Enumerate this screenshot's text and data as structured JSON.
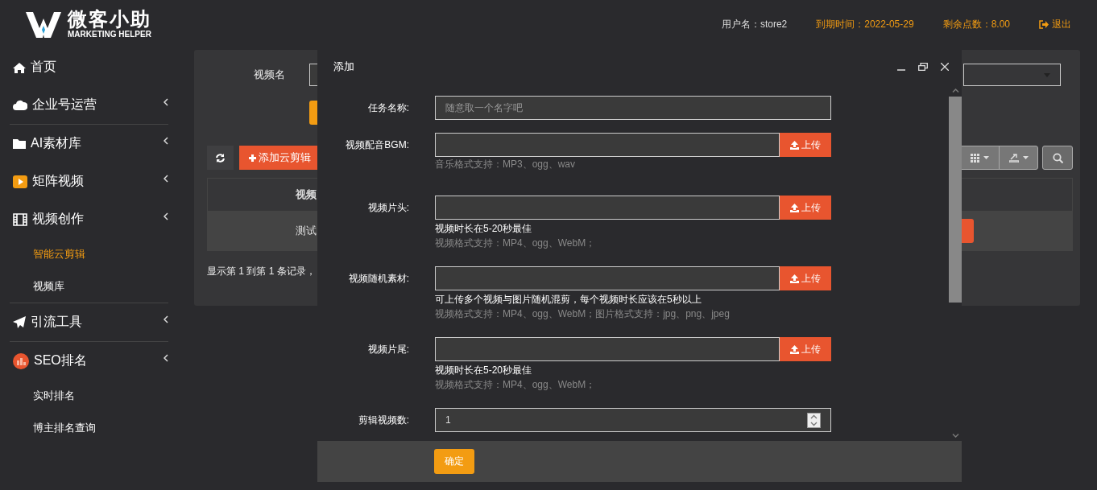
{
  "header": {
    "logo": {
      "title": "微客小助",
      "subtitle": "MARKETING HELPER"
    },
    "user_info": [
      {
        "text": "用户名：store2",
        "kind": "plain"
      },
      {
        "text": "到期时间：2022-05-29",
        "kind": "accent"
      },
      {
        "text": "剩余点数：8.00",
        "kind": "accent"
      }
    ],
    "logout": "退出"
  },
  "sidebar": {
    "sections": [
      [
        {
          "label": "首页",
          "has_submenu": false
        },
        {
          "label": "企业号运营",
          "has_submenu": true
        }
      ],
      [
        {
          "label": "AI素材库",
          "has_submenu": true
        },
        {
          "label": "矩阵视频",
          "has_submenu": true
        },
        {
          "label": "视频创作",
          "has_submenu": true,
          "children": [
            {
              "label": "智能云剪辑",
              "selected": true
            },
            {
              "label": "视频库",
              "selected": false
            }
          ]
        }
      ],
      [
        {
          "label": "引流工具",
          "has_submenu": true
        }
      ],
      [
        {
          "label": "SEO排名",
          "has_submenu": true,
          "children": [
            {
              "label": "实时排名",
              "selected": false
            },
            {
              "label": "博主排名查询",
              "selected": false
            }
          ]
        }
      ]
    ]
  },
  "panel": {
    "search_label": "视频名",
    "add_button": "添加云剪辑",
    "table": {
      "columns": [
        "视频"
      ],
      "rows": [
        [
          "测试"
        ]
      ]
    },
    "pagination": "显示第 1 到第 1 条记录，"
  },
  "dialog": {
    "title": "添加",
    "fields": [
      {
        "label": "任务名称:",
        "kind": "text",
        "placeholder": "随意取一个名字吧"
      },
      {
        "label": "视频配音BGM:",
        "kind": "upload",
        "button": "上传",
        "notes": [
          {
            "text": "音乐格式支持：MP3、ogg、wav",
            "kind": "hint"
          }
        ]
      },
      {
        "label": "视频片头:",
        "kind": "upload",
        "button": "上传",
        "notes": [
          {
            "text": "视频时长在5-20秒最佳",
            "kind": "info"
          },
          {
            "text": "视频格式支持：MP4、ogg、WebM；",
            "kind": "hint"
          }
        ]
      },
      {
        "label": "视频随机素材:",
        "kind": "upload",
        "button": "上传",
        "notes": [
          {
            "text": "可上传多个视频与图片随机混剪，每个视频时长应该在5秒以上",
            "kind": "info"
          },
          {
            "text": "视频格式支持：MP4、ogg、WebM；图片格式支持：jpg、png、jpeg",
            "kind": "hint"
          }
        ]
      },
      {
        "label": "视频片尾:",
        "kind": "upload",
        "button": "上传",
        "notes": [
          {
            "text": "视频时长在5-20秒最佳",
            "kind": "info"
          },
          {
            "text": "视频格式支持：MP4、ogg、WebM；",
            "kind": "hint"
          }
        ]
      },
      {
        "label": "剪辑视频数:",
        "kind": "number",
        "value": "1"
      }
    ],
    "submit": "确定"
  }
}
